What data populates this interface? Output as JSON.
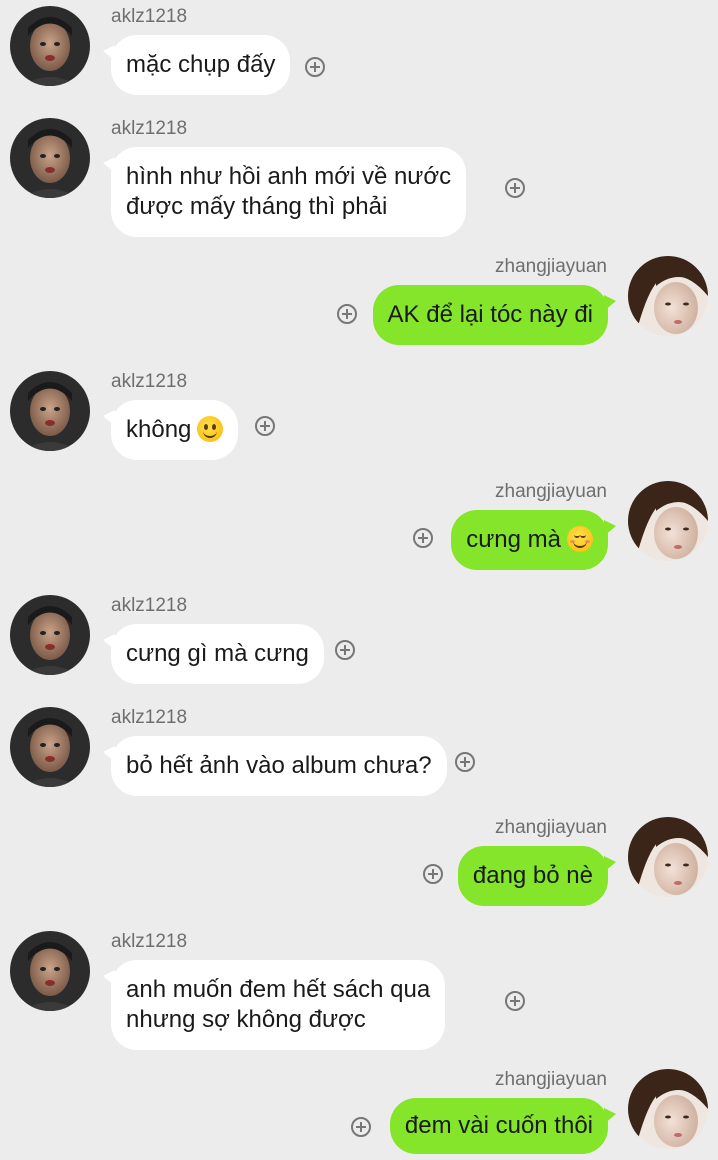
{
  "chat": {
    "messages": [
      {
        "sender": "aklz1218",
        "side": "left",
        "text": "mặc chụp đấy"
      },
      {
        "sender": "aklz1218",
        "side": "left",
        "line1": "hình như hồi anh mới về nước",
        "line2": "được mấy tháng thì phải"
      },
      {
        "sender": "zhangjiayuan",
        "side": "right",
        "text": "AK để lại tóc này đi"
      },
      {
        "sender": "aklz1218",
        "side": "left",
        "text": "không",
        "emoji": "slight-smile-emoji"
      },
      {
        "sender": "zhangjiayuan",
        "side": "right",
        "text": "cưng mà",
        "emoji": "blush-smile-emoji"
      },
      {
        "sender": "aklz1218",
        "side": "left",
        "text": "cưng gì mà cưng"
      },
      {
        "sender": "aklz1218",
        "side": "left",
        "text": "bỏ hết ảnh vào album chưa?"
      },
      {
        "sender": "zhangjiayuan",
        "side": "right",
        "text": "đang bỏ nè"
      },
      {
        "sender": "aklz1218",
        "side": "left",
        "line1": "anh muốn đem hết sách qua",
        "line2": "nhưng sợ không được"
      },
      {
        "sender": "zhangjiayuan",
        "side": "right",
        "text": "đem vài cuốn thôi"
      }
    ]
  },
  "colors": {
    "background": "#ececec",
    "incoming_bubble": "#ffffff",
    "outgoing_bubble": "#84e52a",
    "username": "#6e6e6e"
  }
}
